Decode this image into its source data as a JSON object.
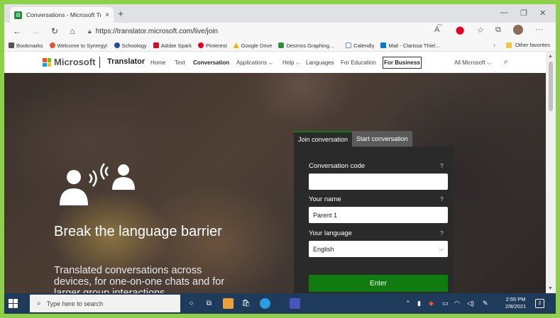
{
  "browser": {
    "tab_title": "Conversations - Microsoft Transl",
    "tab_close": "×",
    "new_tab": "+",
    "url": "https://translator.microsoft.com/live/join",
    "bookmarks": [
      {
        "label": "Bookmarks",
        "color": "#555555"
      },
      {
        "label": "Welcome to Synergy!",
        "color": "#e0592a"
      },
      {
        "label": "Schoology",
        "color": "#1e4f9c"
      },
      {
        "label": "Adobe Spark",
        "color": "#c8102e"
      },
      {
        "label": "Pinterest",
        "color": "#e60023"
      },
      {
        "label": "Google Drive",
        "color": "#f4b400"
      },
      {
        "label": "Desmos Graphing...",
        "color": "#2f8f3a"
      },
      {
        "label": "Calendly",
        "color": "#6b8fd6"
      },
      {
        "label": "Mail - Clarissa Thiel...",
        "color": "#0078d4"
      }
    ],
    "other_favorites": "Other favorites"
  },
  "site": {
    "brand": "Microsoft",
    "product": "Translator",
    "nav": [
      {
        "label": "Home"
      },
      {
        "label": "Text"
      },
      {
        "label": "Conversation"
      },
      {
        "label": "Applications ⌵"
      },
      {
        "label": "Help ⌵"
      },
      {
        "label": "Languages"
      },
      {
        "label": "For Education"
      }
    ],
    "for_business": "For Business",
    "all_microsoft": "All Microsoft ⌵"
  },
  "hero": {
    "title": "Break the language barrier",
    "subtitle": "Translated conversations across devices, for one-on-one chats and for larger group interactions."
  },
  "panel": {
    "tabs": [
      "Join conversation",
      "Start conversation"
    ],
    "code_label": "Conversation code",
    "code_value": "",
    "name_label": "Your name",
    "name_value": "Parent 1",
    "language_label": "Your language",
    "language_value": "English",
    "help": "?",
    "enter": "Enter"
  },
  "taskbar": {
    "search_placeholder": "Type here to search",
    "time": "2:55 PM",
    "date": "2/8/2021",
    "notifications": "2"
  },
  "colors": {
    "accent_green": "#107c10",
    "panel_bg": "#2a2a2a",
    "taskbar_bg": "#1f3b5c",
    "border_green": "#8ed04a"
  }
}
